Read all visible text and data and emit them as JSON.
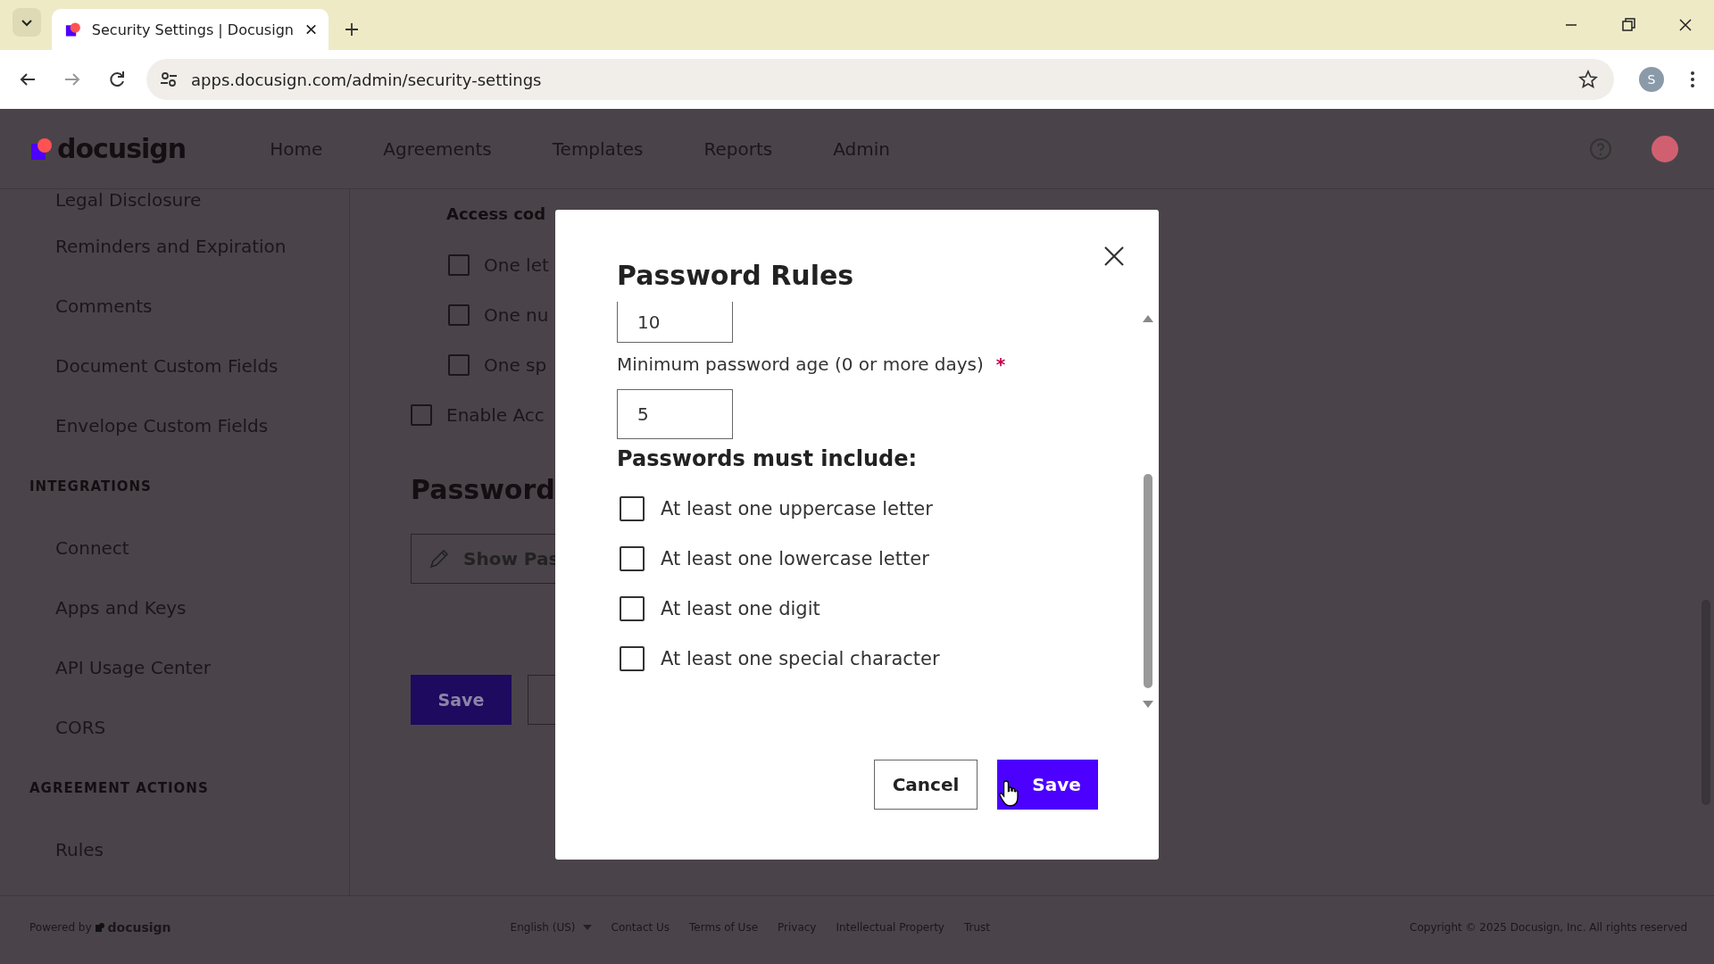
{
  "browser": {
    "tab_title": "Security Settings | Docusign",
    "url": "apps.docusign.com/admin/security-settings",
    "profile_initial": "S"
  },
  "header": {
    "logo": "docusign",
    "nav": [
      {
        "label": "Home",
        "selected": false
      },
      {
        "label": "Agreements",
        "selected": false
      },
      {
        "label": "Templates",
        "selected": false
      },
      {
        "label": "Reports",
        "selected": false
      },
      {
        "label": "Admin",
        "selected": false
      }
    ]
  },
  "sidebar": {
    "items": [
      {
        "kind": "link",
        "label": "Legal Disclosure"
      },
      {
        "kind": "link",
        "label": "Reminders and Expiration"
      },
      {
        "kind": "link",
        "label": "Comments"
      },
      {
        "kind": "link",
        "label": "Document Custom Fields"
      },
      {
        "kind": "link",
        "label": "Envelope Custom Fields"
      },
      {
        "kind": "heading",
        "label": "INTEGRATIONS"
      },
      {
        "kind": "link",
        "label": "Connect"
      },
      {
        "kind": "link",
        "label": "Apps and Keys"
      },
      {
        "kind": "link",
        "label": "API Usage Center"
      },
      {
        "kind": "link",
        "label": "CORS"
      },
      {
        "kind": "heading",
        "label": "AGREEMENT ACTIONS"
      },
      {
        "kind": "link",
        "label": "Rules"
      }
    ]
  },
  "content": {
    "access_code_label": "Access cod",
    "access_code_options": [
      {
        "label": "One let",
        "checked": false
      },
      {
        "label": "One nu",
        "checked": false
      },
      {
        "label": "One sp",
        "checked": false
      }
    ],
    "enable_option": {
      "label": "Enable Acc",
      "checked": false
    },
    "section_title": "Password",
    "show_button": "Show Pas",
    "save_button": "Save"
  },
  "modal": {
    "title": "Password Rules",
    "first_value": "10",
    "min_age_label": "Minimum password age (0 or more days)",
    "required_mark": "*",
    "min_age_value": "5",
    "include_heading": "Passwords must include:",
    "rules": [
      {
        "label": "At least one uppercase letter",
        "checked": false
      },
      {
        "label": "At least one lowercase letter",
        "checked": false
      },
      {
        "label": "At least one digit",
        "checked": false
      },
      {
        "label": "At least one special character",
        "checked": false
      }
    ],
    "cancel": "Cancel",
    "save": "Save"
  },
  "footer": {
    "powered_by": "Powered by",
    "brand": "docusign",
    "language": "English (US)",
    "links": [
      "Contact Us",
      "Terms of Use",
      "Privacy",
      "Intellectual Property",
      "Trust"
    ],
    "copyright": "Copyright © 2025 Docusign, Inc. All rights reserved"
  }
}
